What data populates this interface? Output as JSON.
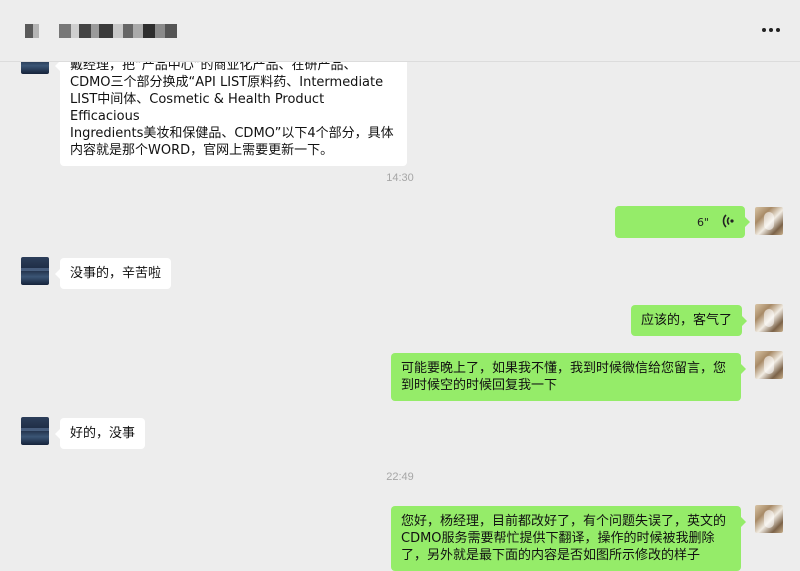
{
  "header": {
    "title_blurred": true,
    "more_icon": "more-horizontal-icon"
  },
  "messages": [
    {
      "side": "left",
      "text_lines": [
        "戴经理，把“产品中心”的商业化产品、在研产品、",
        "CDMO三个部分换成“API LIST原料药、Intermediate",
        "LIST中间体、Cosmetic & Health Product Efficacious",
        "Ingredients美妆和保健品、CDMO”以下4个部分，具体",
        "内容就是那个WORD，官网上需要更新一下。"
      ]
    },
    {
      "type": "time",
      "text": "14:30"
    },
    {
      "side": "right",
      "type": "voice",
      "duration": "6\"",
      "icon": "voice-wave-icon"
    },
    {
      "side": "left",
      "text": "没事的，辛苦啦"
    },
    {
      "side": "right",
      "text": "应该的，客气了"
    },
    {
      "side": "right",
      "text_lines": [
        "可能要晚上了，如果我不懂，我到时候微信给您留言，您",
        "到时候空的时候回复我一下"
      ]
    },
    {
      "side": "left",
      "text": "好的，没事"
    },
    {
      "type": "time",
      "text": "22:49"
    },
    {
      "side": "right",
      "text_lines": [
        "您好，杨经理，目前都改好了，有个问题失误了，英文的",
        "CDMO服务需要帮忙提供下翻译，操作的时候被我删除",
        "了，另外就是最下面的内容是否如图所示修改的样子"
      ]
    }
  ],
  "colors": {
    "background": "#ededed",
    "bubble_self": "#95ec69",
    "bubble_other": "#ffffff",
    "timestamp": "#a6a6a6"
  }
}
